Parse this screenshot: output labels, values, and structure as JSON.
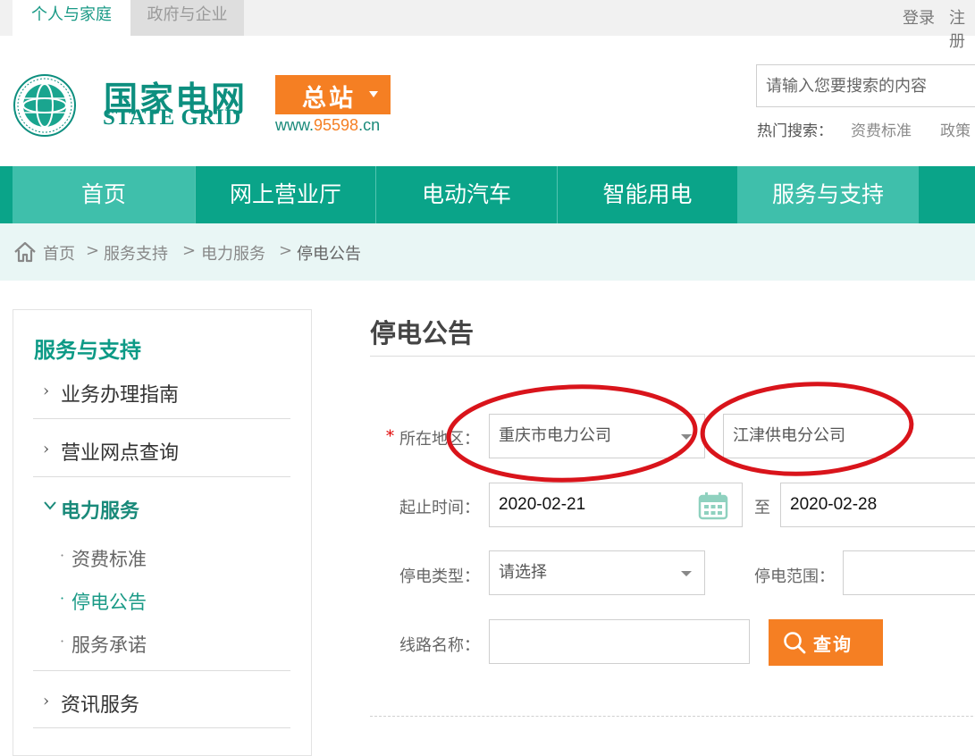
{
  "topbar": {
    "tabs": [
      {
        "label": "个人与家庭",
        "active": true
      },
      {
        "label": "政府与企业",
        "active": false
      }
    ],
    "links": {
      "login": "登录",
      "register": "注册"
    }
  },
  "logo": {
    "name_cn": "国家电网",
    "name_en": "STATE GRID",
    "station_label": "总站",
    "site_prefix": "www.",
    "site_number": "95598",
    "site_suffix": ".cn"
  },
  "search": {
    "placeholder": "请输入您要搜索的内容",
    "hot_label": "热门搜索：",
    "hot_items": [
      "资费标准",
      "政策"
    ]
  },
  "nav": {
    "items": [
      "首页",
      "网上营业厅",
      "电动汽车",
      "智能用电",
      "服务与支持"
    ]
  },
  "breadcrumb": {
    "items": [
      "首页",
      "服务支持",
      "电力服务",
      "停电公告"
    ],
    "separator": ">"
  },
  "sidebar": {
    "title": "服务与支持",
    "items": [
      {
        "label": "业务办理指南",
        "expanded": false
      },
      {
        "label": "营业网点查询",
        "expanded": false
      },
      {
        "label": "电力服务",
        "expanded": true
      },
      {
        "label": "资讯服务",
        "expanded": false
      }
    ],
    "subitems": [
      {
        "label": "资费标准",
        "active": false
      },
      {
        "label": "停电公告",
        "active": true
      },
      {
        "label": "服务承诺",
        "active": false
      }
    ]
  },
  "main": {
    "title": "停电公告",
    "form": {
      "required_mark": "*",
      "region_label": "所在地区：",
      "region_company": "重庆市电力公司",
      "region_branch": "江津供电分公司",
      "date_label": "起止时间：",
      "date_start": "2020-02-21",
      "date_to": "至",
      "date_end": "2020-02-28",
      "type_label": "停电类型：",
      "type_value": "请选择",
      "scope_label": "停电范围：",
      "scope_value": "",
      "line_label": "线路名称：",
      "line_value": "",
      "query_label": "查询"
    }
  },
  "colors": {
    "brand_green": "#0aa489",
    "nav_highlight": "#3fbfab",
    "accent_orange": "#f57f23",
    "annotation_red": "#d9141b"
  }
}
